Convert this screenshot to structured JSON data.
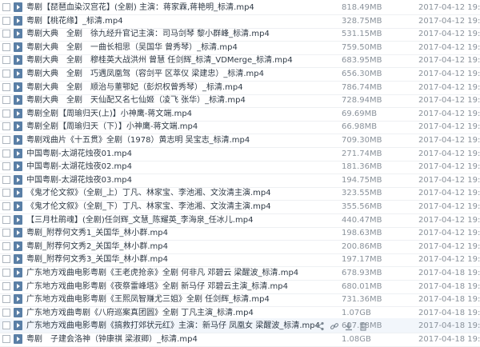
{
  "files": [
    {
      "name": "粤剧【琵琶血染汉宫花】(全剧) 主演：蒋家霖,蒋艳明_标清.mp4",
      "size": "818.49MB",
      "date": "2017-04-12 19:28"
    },
    {
      "name": "粤剧【桃花缘】_标清.mp4",
      "size": "328.75MB",
      "date": "2017-04-12 19:28"
    },
    {
      "name": "粤剧大典　全剧　徐九经升官记主演：司马剑琴 黎小群峰_标清.mp4",
      "size": "531.15MB",
      "date": "2017-04-12 19:28"
    },
    {
      "name": "粤剧大典　全剧　一曲长相思（吴国华 曾秀琴）_标清.mp4",
      "size": "759.50MB",
      "date": "2017-04-12 19:28"
    },
    {
      "name": "粤剧大典　全剧　穆桂英大战洪州 曾慧 任剑辉_标清_VDMerge_标清.mp4",
      "size": "683.95MB",
      "date": "2017-04-12 19:28"
    },
    {
      "name": "粤剧大典　全剧　巧遇凤凰驾（容剑平 区萃仪 梁建忠）_标清.mp4",
      "size": "656.30MB",
      "date": "2017-04-12 19:28"
    },
    {
      "name": "粤剧大典　全剧　顺治与董鄂妃（彭炽权曾秀琴）_标清.mp4",
      "size": "786.74MB",
      "date": "2017-04-12 19:28"
    },
    {
      "name": "粤剧大典　全剧　天仙配又名七仙姬（凌飞 张华）_标清.mp4",
      "size": "728.94MB",
      "date": "2017-04-12 19:28"
    },
    {
      "name": "粤剧全剧【周瑜归天(上)】小神鹰-蒋文端.mp4",
      "size": "69.69MB",
      "date": "2017-04-12 19:28"
    },
    {
      "name": "粤剧全剧【周瑜归天（下）】小神鹰-蒋文端.mp4",
      "size": "66.98MB",
      "date": "2017-04-12 19:28"
    },
    {
      "name": "粤剧戏曲片《十五贯》全剧（1978）黄志明 吴宝志_标清.mp4",
      "size": "709.30MB",
      "date": "2017-04-12 19:28"
    },
    {
      "name": "中国粤剧-太湖花烛夜01.mp4",
      "size": "271.74MB",
      "date": "2017-04-12 19:28"
    },
    {
      "name": "中国粤剧-太湖花烛夜02.mp4",
      "size": "181.36MB",
      "date": "2017-04-12 19:28"
    },
    {
      "name": "中国粤剧-太湖花烛夜03.mp4",
      "size": "194.75MB",
      "date": "2017-04-12 19:28"
    },
    {
      "name": "《鬼才伦文叙》（全剧_上）丁凡、林家宝、李池湘、文汝清主演.mp4",
      "size": "323.55MB",
      "date": "2017-04-12 19:28"
    },
    {
      "name": "《鬼才伦文叙》（全剧_下）丁凡、林家宝、李池湘、文汝清主演.mp4",
      "size": "355.56MB",
      "date": "2017-04-12 19:28"
    },
    {
      "name": "【三月杜鹃魂】(全剧)任剑辉_文慧_陈耀英_李海泉_任冰儿.mp4",
      "size": "440.47MB",
      "date": "2017-04-12 19:28"
    },
    {
      "name": "粤剧_附荐何文秀1_关国华_林小群.mp4",
      "size": "198.63MB",
      "date": "2017-04-12 19:28"
    },
    {
      "name": "粤剧_附荐何文秀2_关国华_林小群.mp4",
      "size": "200.86MB",
      "date": "2017-04-12 19:28"
    },
    {
      "name": "粤剧_附荐何文秀3_关国华_林小群.mp4",
      "size": "197.17MB",
      "date": "2017-04-12 19:28"
    },
    {
      "name": "广东地方戏曲电影粤剧《王老虎抢亲》全剧 何非凡 邓碧云 梁醒波_标清.mp4",
      "size": "678.93MB",
      "date": "2017-04-18 19:28"
    },
    {
      "name": "广东地方戏曲电影粤剧《夜祭雷峰塔》全剧 新马仔 邓碧云主演_标清.mp4",
      "size": "680.01MB",
      "date": "2017-04-18 19:28"
    },
    {
      "name": "广东地方戏曲电影粤剧《王熙凤智赚尤三姐》全剧 任剑辉_标清.mp4",
      "size": "731.36MB",
      "date": "2017-04-18 19:28"
    },
    {
      "name": "广东地方戏曲粤剧《八府巡案真团圆》全剧 丁凡主演_标清.mp4",
      "size": "1.07GB",
      "date": "2017-04-18 19:28"
    },
    {
      "name": "广东地方戏曲电影粤剧《搞救打郊状元红》主演：新马仔 凤凰女 梁醒波_标清.mp4",
      "size": "607.18MB",
      "date": "2017-04-18 19:28"
    },
    {
      "name": "粤剧　子建会洛神（钟康祺 梁淑卿）_标清.mp4",
      "size": "1.08GB",
      "date": "2017-04-18 19:28"
    }
  ],
  "row_actions": {
    "icons": [
      "share-icon",
      "link-icon",
      "download-icon",
      "delete-icon"
    ]
  },
  "colors": {
    "file_icon": "#5a7fa6",
    "text": "#2f3a46",
    "meta_text": "#8a929b",
    "hover_row": "#f2f6fb"
  }
}
